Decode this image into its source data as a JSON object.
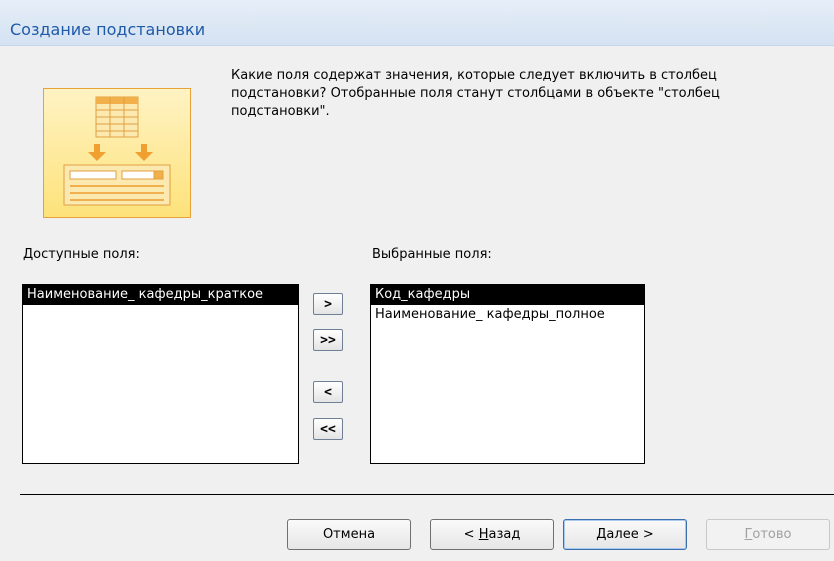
{
  "window": {
    "title": "Создание подстановки"
  },
  "instructions": "Какие поля содержат значения, которые следует включить в столбец подстановки? Отобранные поля станут столбцами в объекте \"столбец подстановки\".",
  "available": {
    "label": "Доступные поля:",
    "items": [
      "Наименование_ кафедры_краткое"
    ]
  },
  "selected": {
    "label": "Выбранные поля:",
    "items": [
      "Код_кафедры",
      "Наименование_ кафедры_полное"
    ]
  },
  "move_buttons": {
    "add_one": ">",
    "add_all": ">>",
    "remove_one": "<",
    "remove_all": "<<"
  },
  "footer": {
    "cancel": "Отмена",
    "back_prefix": "< ",
    "back_accel": "Н",
    "back_rest": "азад",
    "next_accel": "Д",
    "next_rest": "алее >",
    "finish_accel": "Г",
    "finish_rest": "отово"
  }
}
